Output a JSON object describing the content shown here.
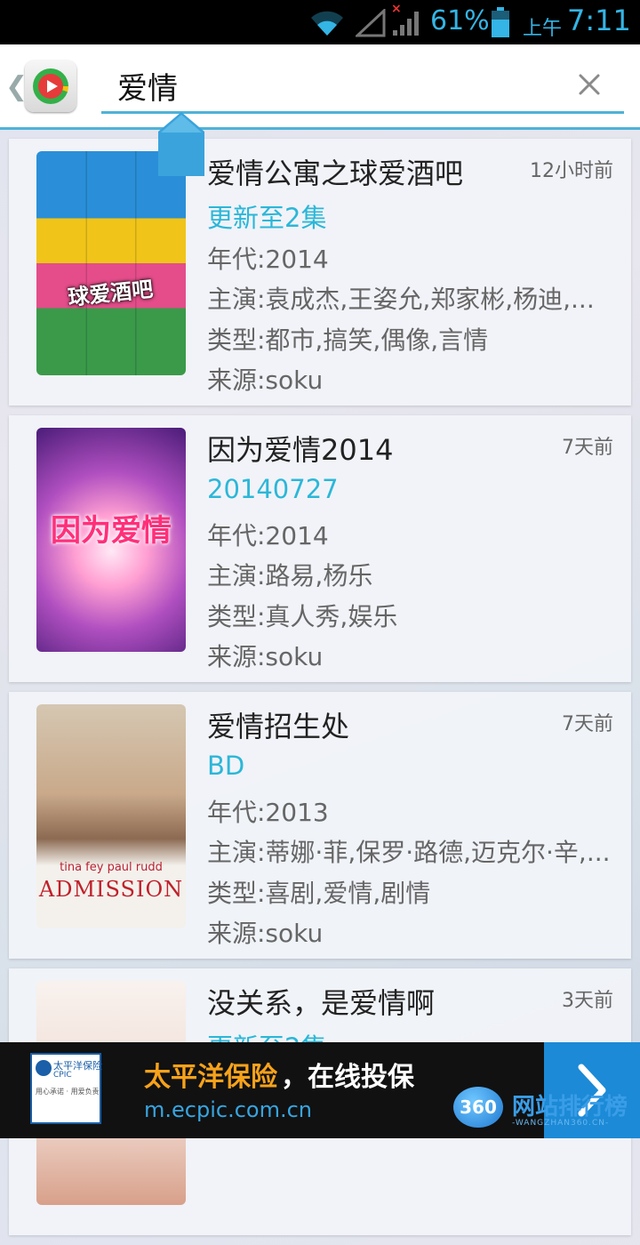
{
  "status_bar": {
    "battery_percent": "61%",
    "ampm": "上午",
    "time": "7:11"
  },
  "search": {
    "query": "爱情",
    "clear_icon": "close-icon",
    "back_icon": "chevron-left-icon",
    "app_icon": "video-app-logo"
  },
  "results": [
    {
      "title": "爱情公寓之球爱酒吧",
      "time_ago": "12小时前",
      "update": "更新至2集",
      "year": "年代:2014",
      "cast": "主演:袁成杰,王姿允,郑家彬,杨迪,...",
      "genre": "类型:都市,搞笑,偶像,言情",
      "source": "来源:soku",
      "poster_text": "球爱酒吧"
    },
    {
      "title": "因为爱情2014",
      "time_ago": "7天前",
      "update": "20140727",
      "year": "年代:2014",
      "cast": "主演:路易,杨乐",
      "genre": "类型:真人秀,娱乐",
      "source": "来源:soku",
      "poster_text": "因为爱情"
    },
    {
      "title": "爱情招生处",
      "time_ago": "7天前",
      "update": "BD",
      "year": "年代:2013",
      "cast": "主演:蒂娜·菲,保罗·路德,迈克尔·辛,...",
      "genre": "类型:喜剧,爱情,剧情",
      "source": "来源:soku",
      "poster_text": "tina fey  paul rudd",
      "poster_text_2": "ADMISSION"
    },
    {
      "title": "没关系，是爱情啊",
      "time_ago": "3天前",
      "update": "更新至2集"
    }
  ],
  "ad": {
    "title_brand": "太平洋保险",
    "title_rest": "，在线投保",
    "url": "m.ecpic.com.cn",
    "logo_text": "太平洋保险",
    "logo_sub": "CPIC",
    "logo_slogan": "用心承诺 · 用爱负责"
  },
  "watermark": {
    "badge": "360",
    "text": "网站排行榜",
    "sub": "-WANGZHAN360.CN-"
  },
  "colors": {
    "accent": "#34b5e5",
    "update_text": "#2bb7d8",
    "ad_brand": "#f7a21b",
    "ad_url": "#37a5e0"
  }
}
